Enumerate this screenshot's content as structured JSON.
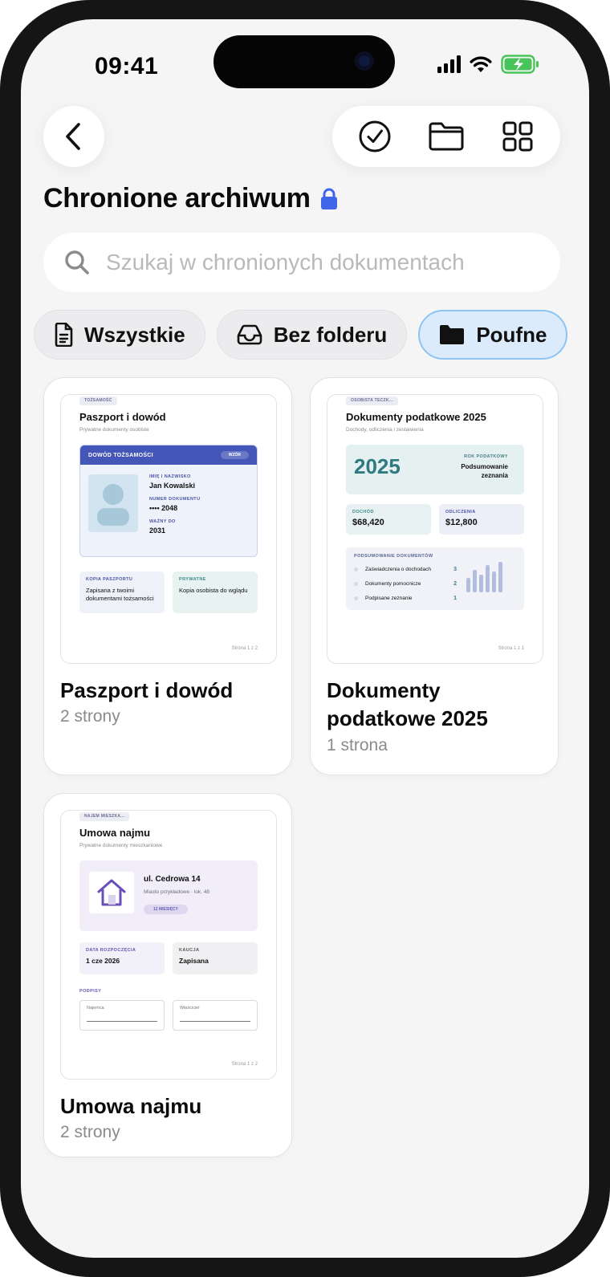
{
  "status_bar": {
    "time": "09:41"
  },
  "header": {
    "title": "Chronione archiwum"
  },
  "search": {
    "placeholder": "Szukaj w chronionych dokumentach"
  },
  "filters": [
    {
      "label": "Wszystkie",
      "icon": "document-icon",
      "active": false
    },
    {
      "label": "Bez folderu",
      "icon": "tray-icon",
      "active": false
    },
    {
      "label": "Poufne",
      "icon": "folder-icon",
      "active": true
    }
  ],
  "colors": {
    "accent": "#3f67e8",
    "chip_active_bg": "#dcebfb",
    "chip_active_border": "#8ec3f2",
    "battery": "#49c45b"
  },
  "documents": [
    {
      "name": "Paszport i dowód",
      "pages": "2 strony",
      "preview": {
        "tag": "TOŻSAMOŚĆ",
        "title": "Paszport i dowód",
        "subtitle": "Prywatne dokumenty osobiste",
        "id_header": "DOWÓD TOŻSAMOŚCI",
        "id_badge": "WZÓR",
        "name_label": "IMIĘ I NAZWISKO",
        "name_value": "Jan Kowalski",
        "number_label": "NUMER DOKUMENTU",
        "number_value": "•••• 2048",
        "valid_label": "WAŻNY DO",
        "valid_value": "2031",
        "box1_label": "KOPIA PASZPORTU",
        "box1_text": "Zapisana z twoimi dokumentami tożsamości",
        "box2_label": "PRYWATNE",
        "box2_text": "Kopia osobista do wglądu",
        "footer": "Strona 1 z 2"
      }
    },
    {
      "name": "Dokumenty podatkowe 2025",
      "pages": "1 strona",
      "preview": {
        "tag": "OSOBISTA TECZK...",
        "title": "Dokumenty podatkowe 2025",
        "subtitle": "Dochody, odliczenia i zestawienia",
        "year": "2025",
        "year_label": "ROK PODATKOWY",
        "year_text": "Podsumowanie zeznania",
        "income_label": "DOCHÓD",
        "income_value": "$68,420",
        "deductions_label": "ODLICZENIA",
        "deductions_value": "$12,800",
        "summary_label": "PODSUMOWANIE DOKUMENTÓW",
        "rows": [
          {
            "label": "Zaświadczenia o dochodach",
            "count": "3"
          },
          {
            "label": "Dokumenty pomocnicze",
            "count": "2"
          },
          {
            "label": "Podpisane zeznanie",
            "count": "1"
          }
        ],
        "footer": "Strona 1 z 1"
      }
    },
    {
      "name": "Umowa najmu",
      "pages": "2 strony",
      "preview": {
        "tag": "NAJEM MIESZKA...",
        "title": "Umowa najmu",
        "subtitle": "Prywatne dokumenty mieszkaniowe",
        "street": "ul. Cedrowa 14",
        "city": "Miasto przykładowe · lok. 48",
        "term": "12 MIESIĘCY",
        "start_label": "DATA ROZPOCZĘCIA",
        "start_value": "1 cze 2026",
        "deposit_label": "KAUCJA",
        "deposit_value": "Zapisana",
        "signatures_label": "PODPISY",
        "sig1": "Najemca",
        "sig2": "Właściciel",
        "footer": "Strona 1 z 2"
      }
    }
  ]
}
